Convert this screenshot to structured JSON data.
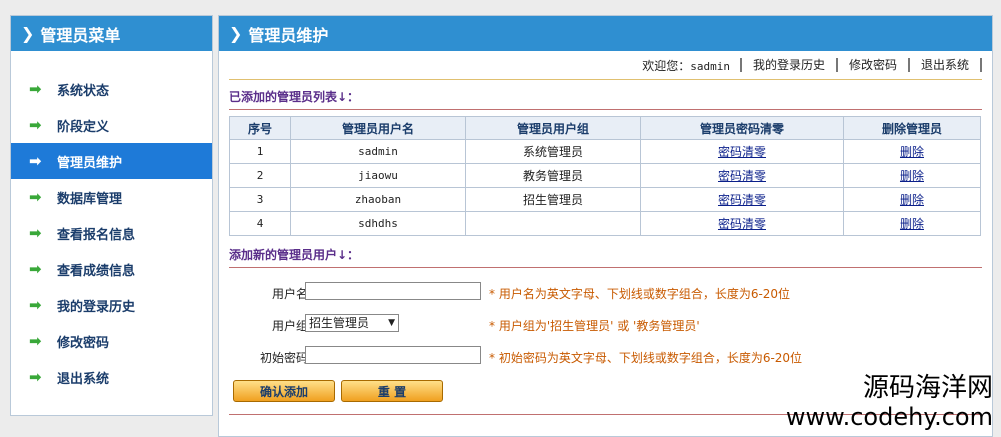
{
  "sidebar": {
    "title": "管理员菜单",
    "items": [
      {
        "label": "系统状态"
      },
      {
        "label": "阶段定义"
      },
      {
        "label": "管理员维护"
      },
      {
        "label": "数据库管理"
      },
      {
        "label": "查看报名信息"
      },
      {
        "label": "查看成绩信息"
      },
      {
        "label": "我的登录历史"
      },
      {
        "label": "修改密码"
      },
      {
        "label": "退出系统"
      }
    ],
    "active_index": 2
  },
  "main": {
    "title": "管理员维护",
    "topbar": {
      "welcome_label": "欢迎您：",
      "username": "sadmin",
      "links": [
        "我的登录历史",
        "修改密码",
        "退出系统"
      ]
    },
    "list_title": "已添加的管理员列表↓：",
    "table": {
      "headers": [
        "序号",
        "管理员用户名",
        "管理员用户组",
        "管理员密码清零",
        "删除管理员"
      ],
      "rows": [
        {
          "no": "1",
          "user": "sadmin",
          "group": "系统管理员",
          "reset": "密码清零",
          "del": "删除"
        },
        {
          "no": "2",
          "user": "jiaowu",
          "group": "教务管理员",
          "reset": "密码清零",
          "del": "删除"
        },
        {
          "no": "3",
          "user": "zhaoban",
          "group": "招生管理员",
          "reset": "密码清零",
          "del": "删除"
        },
        {
          "no": "4",
          "user": "sdhdhs",
          "group": "",
          "reset": "密码清零",
          "del": "删除"
        }
      ]
    },
    "add_title": "添加新的管理员用户↓：",
    "form": {
      "username_label": "用户名:",
      "username_value": "",
      "username_hint": "* 用户名为英文字母、下划线或数字组合，长度为6-20位",
      "group_label": "用户组:",
      "group_selected": "招生管理员",
      "group_hint": "* 用户组为'招生管理员' 或 '教务管理员'",
      "password_label": "初始密码:",
      "password_value": "",
      "password_hint": "* 初始密码为英文字母、下划线或数字组合，长度为6-20位",
      "submit_label": "确认添加",
      "reset_label": "重 置"
    }
  },
  "watermark": {
    "line1": "源码海洋网",
    "line2": "www.codehy.com"
  },
  "colors": {
    "header_blue": "#2f8fd1",
    "active_blue": "#1e7ad8",
    "hint_orange": "#c85a00",
    "title_purple": "#5a2e8a",
    "arrow_green": "#39a839"
  }
}
